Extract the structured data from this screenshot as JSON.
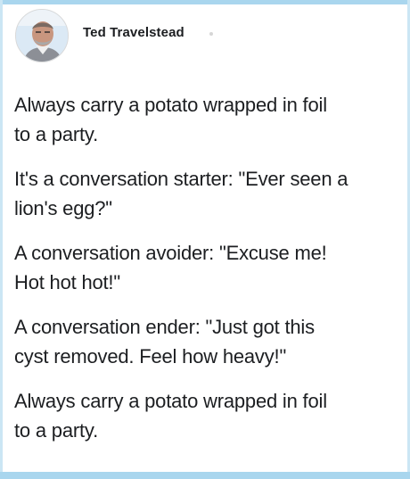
{
  "post": {
    "author_name": "Ted Travelstead",
    "paragraphs": [
      "Always carry a potato wrapped in foil\nto a party.",
      "It's a conversation starter: \"Ever seen a\nlion's egg?\"",
      "A conversation avoider: \"Excuse me!\nHot hot hot!\"",
      "A conversation ender: \"Just got this\ncyst removed. Feel how heavy!\"",
      "Always carry a potato wrapped in foil\nto a party."
    ]
  },
  "colors": {
    "text": "#1c1e21",
    "frame": "#a9d6ee",
    "background": "#ffffff"
  },
  "icons": {
    "avatar": "profile-photo"
  }
}
